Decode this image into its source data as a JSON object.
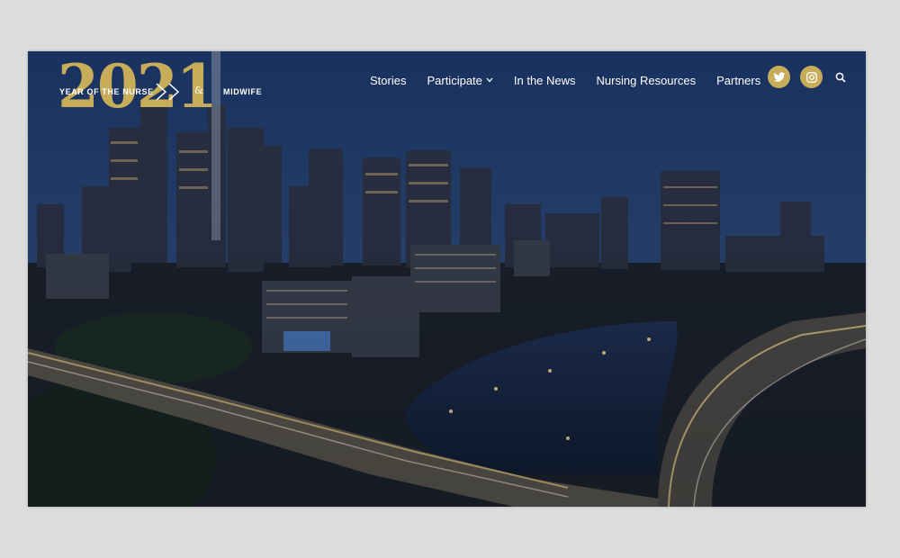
{
  "logo": {
    "year": "2021",
    "tagline_left": "YEAR OF THE NURSE",
    "ampersand": "&",
    "tagline_right": "MIDWIFE"
  },
  "nav": {
    "items": [
      {
        "label": "Stories"
      },
      {
        "label": "Participate",
        "has_dropdown": true
      },
      {
        "label": "In the News"
      },
      {
        "label": "Nursing Resources"
      },
      {
        "label": "Partners"
      }
    ]
  },
  "social": {
    "icons": [
      "twitter-icon",
      "instagram-icon"
    ],
    "search_icon": "search-icon"
  },
  "hero": {
    "description_icon": "city-skyline-photo"
  },
  "colors": {
    "gold": "#c7ad5a",
    "sky_top": "#1f3a6c",
    "sky_bottom": "#2c4a7a",
    "page_bg": "#dcdcdc"
  }
}
